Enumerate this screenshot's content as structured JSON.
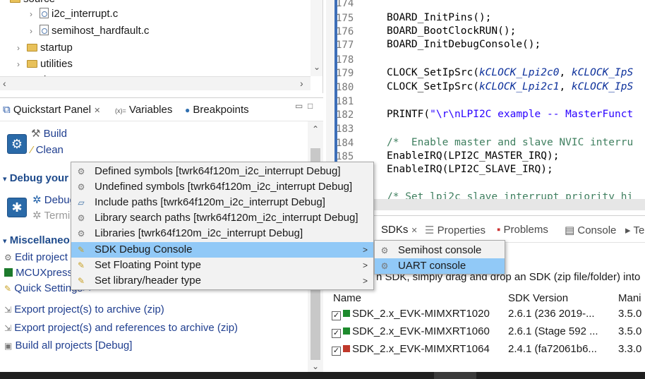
{
  "explorer": {
    "partial_top": "source",
    "files": [
      "i2c_interrupt.c",
      "semihost_hardfault.c"
    ],
    "folders": [
      "startup",
      "utilities"
    ],
    "partial_bottom": "doc"
  },
  "quickstart": {
    "tabs": [
      {
        "label": "Quickstart Panel",
        "close": "✕"
      },
      {
        "label": "Variables",
        "prefix": "(x)="
      },
      {
        "label": "Breakpoints"
      }
    ],
    "build_label": "Build",
    "clean_label": "Clean",
    "debug_section": "Debug your",
    "debug_link": "Debug",
    "terminate_link": "Termin",
    "misc_section": "Miscellaneo",
    "links": [
      "Edit project",
      "MCUXpress",
      "Quick Settings>>",
      "Export project(s) to archive (zip)",
      "Export project(s) and references to archive (zip)",
      "Build all projects [Debug]"
    ]
  },
  "editor": {
    "lines": [
      {
        "n": "174",
        "code": ""
      },
      {
        "n": "175",
        "code": "BOARD_InitPins();"
      },
      {
        "n": "176",
        "code": "BOARD_BootClockRUN();"
      },
      {
        "n": "177",
        "code": "BOARD_InitDebugConsole();"
      },
      {
        "n": "178",
        "code": ""
      },
      {
        "n": "179",
        "code_a": "CLOCK_SetIpSrc(",
        "code_b": "kCLOCK_Lpi2c0",
        "code_c": ", ",
        "code_d": "kCLOCK_IpS"
      },
      {
        "n": "180",
        "code_a": "CLOCK_SetIpSrc(",
        "code_b": "kCLOCK_Lpi2c1",
        "code_c": ", ",
        "code_d": "kCLOCK_IpS"
      },
      {
        "n": "181",
        "code": ""
      },
      {
        "n": "182",
        "code_a": "PRINTF(",
        "code_b": "\"\\r\\nLPI2C example -- MasterFunct"
      },
      {
        "n": "183",
        "code": ""
      },
      {
        "n": "184",
        "code": "/*  Enable master and slave NVIC interru"
      },
      {
        "n": "185",
        "code": "EnableIRQ(LPI2C_MASTER_IRQ);"
      },
      {
        "n": "186",
        "code": "EnableIRQ(LPI2C_SLAVE_IRQ);"
      },
      {
        "n": "187",
        "code": ""
      },
      {
        "n": "188",
        "code": "/* Set lpi2c slave interrupt priority hi"
      }
    ]
  },
  "bottom_view": {
    "tabs": [
      "SDKs",
      "Properties",
      "Problems",
      "Console",
      "Termin"
    ],
    "hint": "n SDK, simply drag and drop an SDK (zip file/folder) into",
    "columns": [
      "Name",
      "SDK Version",
      "Mani"
    ],
    "rows": [
      {
        "name": "SDK_2.x_EVK-MIMXRT1020",
        "version": "2.6.1 (236 2019-...",
        "manifest": "3.5.0"
      },
      {
        "name": "SDK_2.x_EVK-MIMXRT1060",
        "version": "2.6.1 (Stage 592 ...",
        "manifest": "3.5.0"
      },
      {
        "name": "SDK_2.x_EVK-MIMXRT1064",
        "version": "2.4.1 (fa72061b6...",
        "manifest": "3.3.0"
      }
    ]
  },
  "context_menu": {
    "items": [
      {
        "label": "Defined symbols [twrk64f120m_i2c_interrupt Debug]",
        "icon": "gear-icon"
      },
      {
        "label": "Undefined symbols [twrk64f120m_i2c_interrupt Debug]",
        "icon": "gear-icon"
      },
      {
        "label": "Include paths [twrk64f120m_i2c_interrupt Debug]",
        "icon": "include-icon"
      },
      {
        "label": "Library search paths [twrk64f120m_i2c_interrupt Debug]",
        "icon": "gear-icon"
      },
      {
        "label": "Libraries [twrk64f120m_i2c_interrupt Debug]",
        "icon": "gear-icon"
      },
      {
        "label": "SDK Debug Console",
        "icon": "quick-settings-icon",
        "submenu": true,
        "selected": true
      },
      {
        "label": "Set Floating Point type",
        "icon": "quick-settings-icon",
        "submenu": true
      },
      {
        "label": "Set library/header type",
        "icon": "quick-settings-icon",
        "submenu": true
      }
    ],
    "submenu": [
      {
        "label": "Semihost console",
        "icon": "gear-icon"
      },
      {
        "label": "UART console",
        "icon": "gear-icon",
        "selected": true
      }
    ]
  }
}
